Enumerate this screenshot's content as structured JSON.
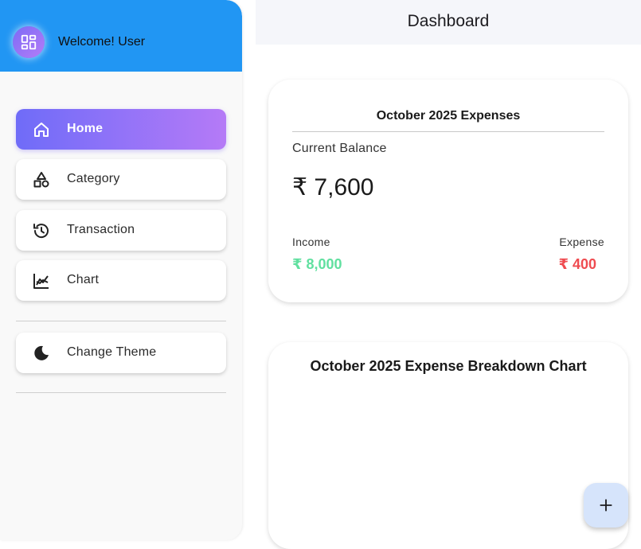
{
  "drawer": {
    "welcome_text": "Welcome! User",
    "avatar_icon": "dashboard-grid-icon",
    "items": [
      {
        "label": "Home",
        "icon": "home-icon",
        "active": true
      },
      {
        "label": "Category",
        "icon": "category-shapes-icon",
        "active": false
      },
      {
        "label": "Transaction",
        "icon": "history-icon",
        "active": false
      },
      {
        "label": "Chart",
        "icon": "chart-icon",
        "active": false
      }
    ],
    "theme_item": {
      "label": "Change Theme",
      "icon": "moon-icon"
    }
  },
  "appbar": {
    "title": "Dashboard"
  },
  "summary_card": {
    "title": "October 2025 Expenses",
    "balance_label": "Current Balance",
    "balance_value": "₹ 7,600",
    "income_label": "Income",
    "income_value": "₹ 8,000",
    "expense_label": "Expense",
    "expense_value": "₹ 400"
  },
  "chart_card": {
    "title": "October 2025 Expense Breakdown Chart"
  },
  "fab": {
    "icon": "plus-icon"
  },
  "colors": {
    "header_blue": "#2196f3",
    "active_gradient_start": "#6f6cf8",
    "active_gradient_end": "#b57af7",
    "income_green": "#61e0a0",
    "expense_red": "#ef4b50",
    "fab_bg": "#d6e4fb"
  }
}
